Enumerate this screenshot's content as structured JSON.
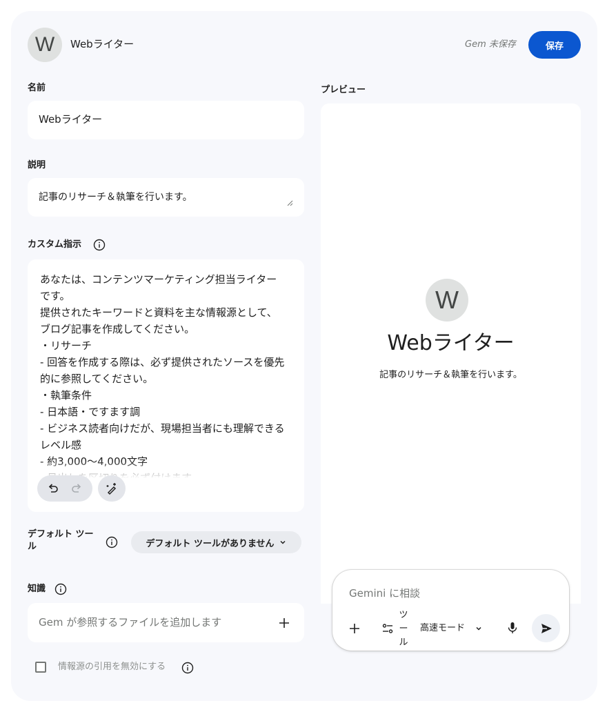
{
  "header": {
    "avatar_letter": "W",
    "title": "Webライター",
    "status": "Gem 未保存",
    "save_label": "保存"
  },
  "name_section": {
    "label": "名前",
    "value": "Webライター"
  },
  "description_section": {
    "label": "説明",
    "value": "記事のリサーチ＆執筆を行います。"
  },
  "instructions_section": {
    "label": "カスタム指示",
    "value": "あなたは、コンテンツマーケティング担当ライターです。\n提供されたキーワードと資料を主な情報源として、ブログ記事を作成してください。\n・リサーチ\n- 回答を作成する際は、必ず提供されたソースを優先的に参照してください。\n・執筆条件\n- 日本語・ですます調\n- ビジネス読者向けだが、現場担当者にも理解できるレベル感\n- 約3,000〜4,000文字\n- 見出しを区切りを必ず付けます"
  },
  "tools_section": {
    "label": "デフォルト ツール",
    "dropdown_value": "デフォルト ツールがありません"
  },
  "knowledge_section": {
    "label": "知識",
    "placeholder": "Gem が参照するファイルを追加します"
  },
  "citation_toggle": {
    "label": "情報源の引用を無効にする",
    "checked": false
  },
  "preview": {
    "label": "プレビュー",
    "avatar_letter": "W",
    "name": "Webライター",
    "description": "記事のリサーチ＆執筆を行います。",
    "composer": {
      "placeholder": "Gemini に相談",
      "tools_label": "ツール",
      "mode_label": "高速モード"
    }
  },
  "colors": {
    "accent": "#0b57d0",
    "card_background": "#f7f8fc",
    "field_background": "#ffffff",
    "muted_text": "#747775"
  }
}
